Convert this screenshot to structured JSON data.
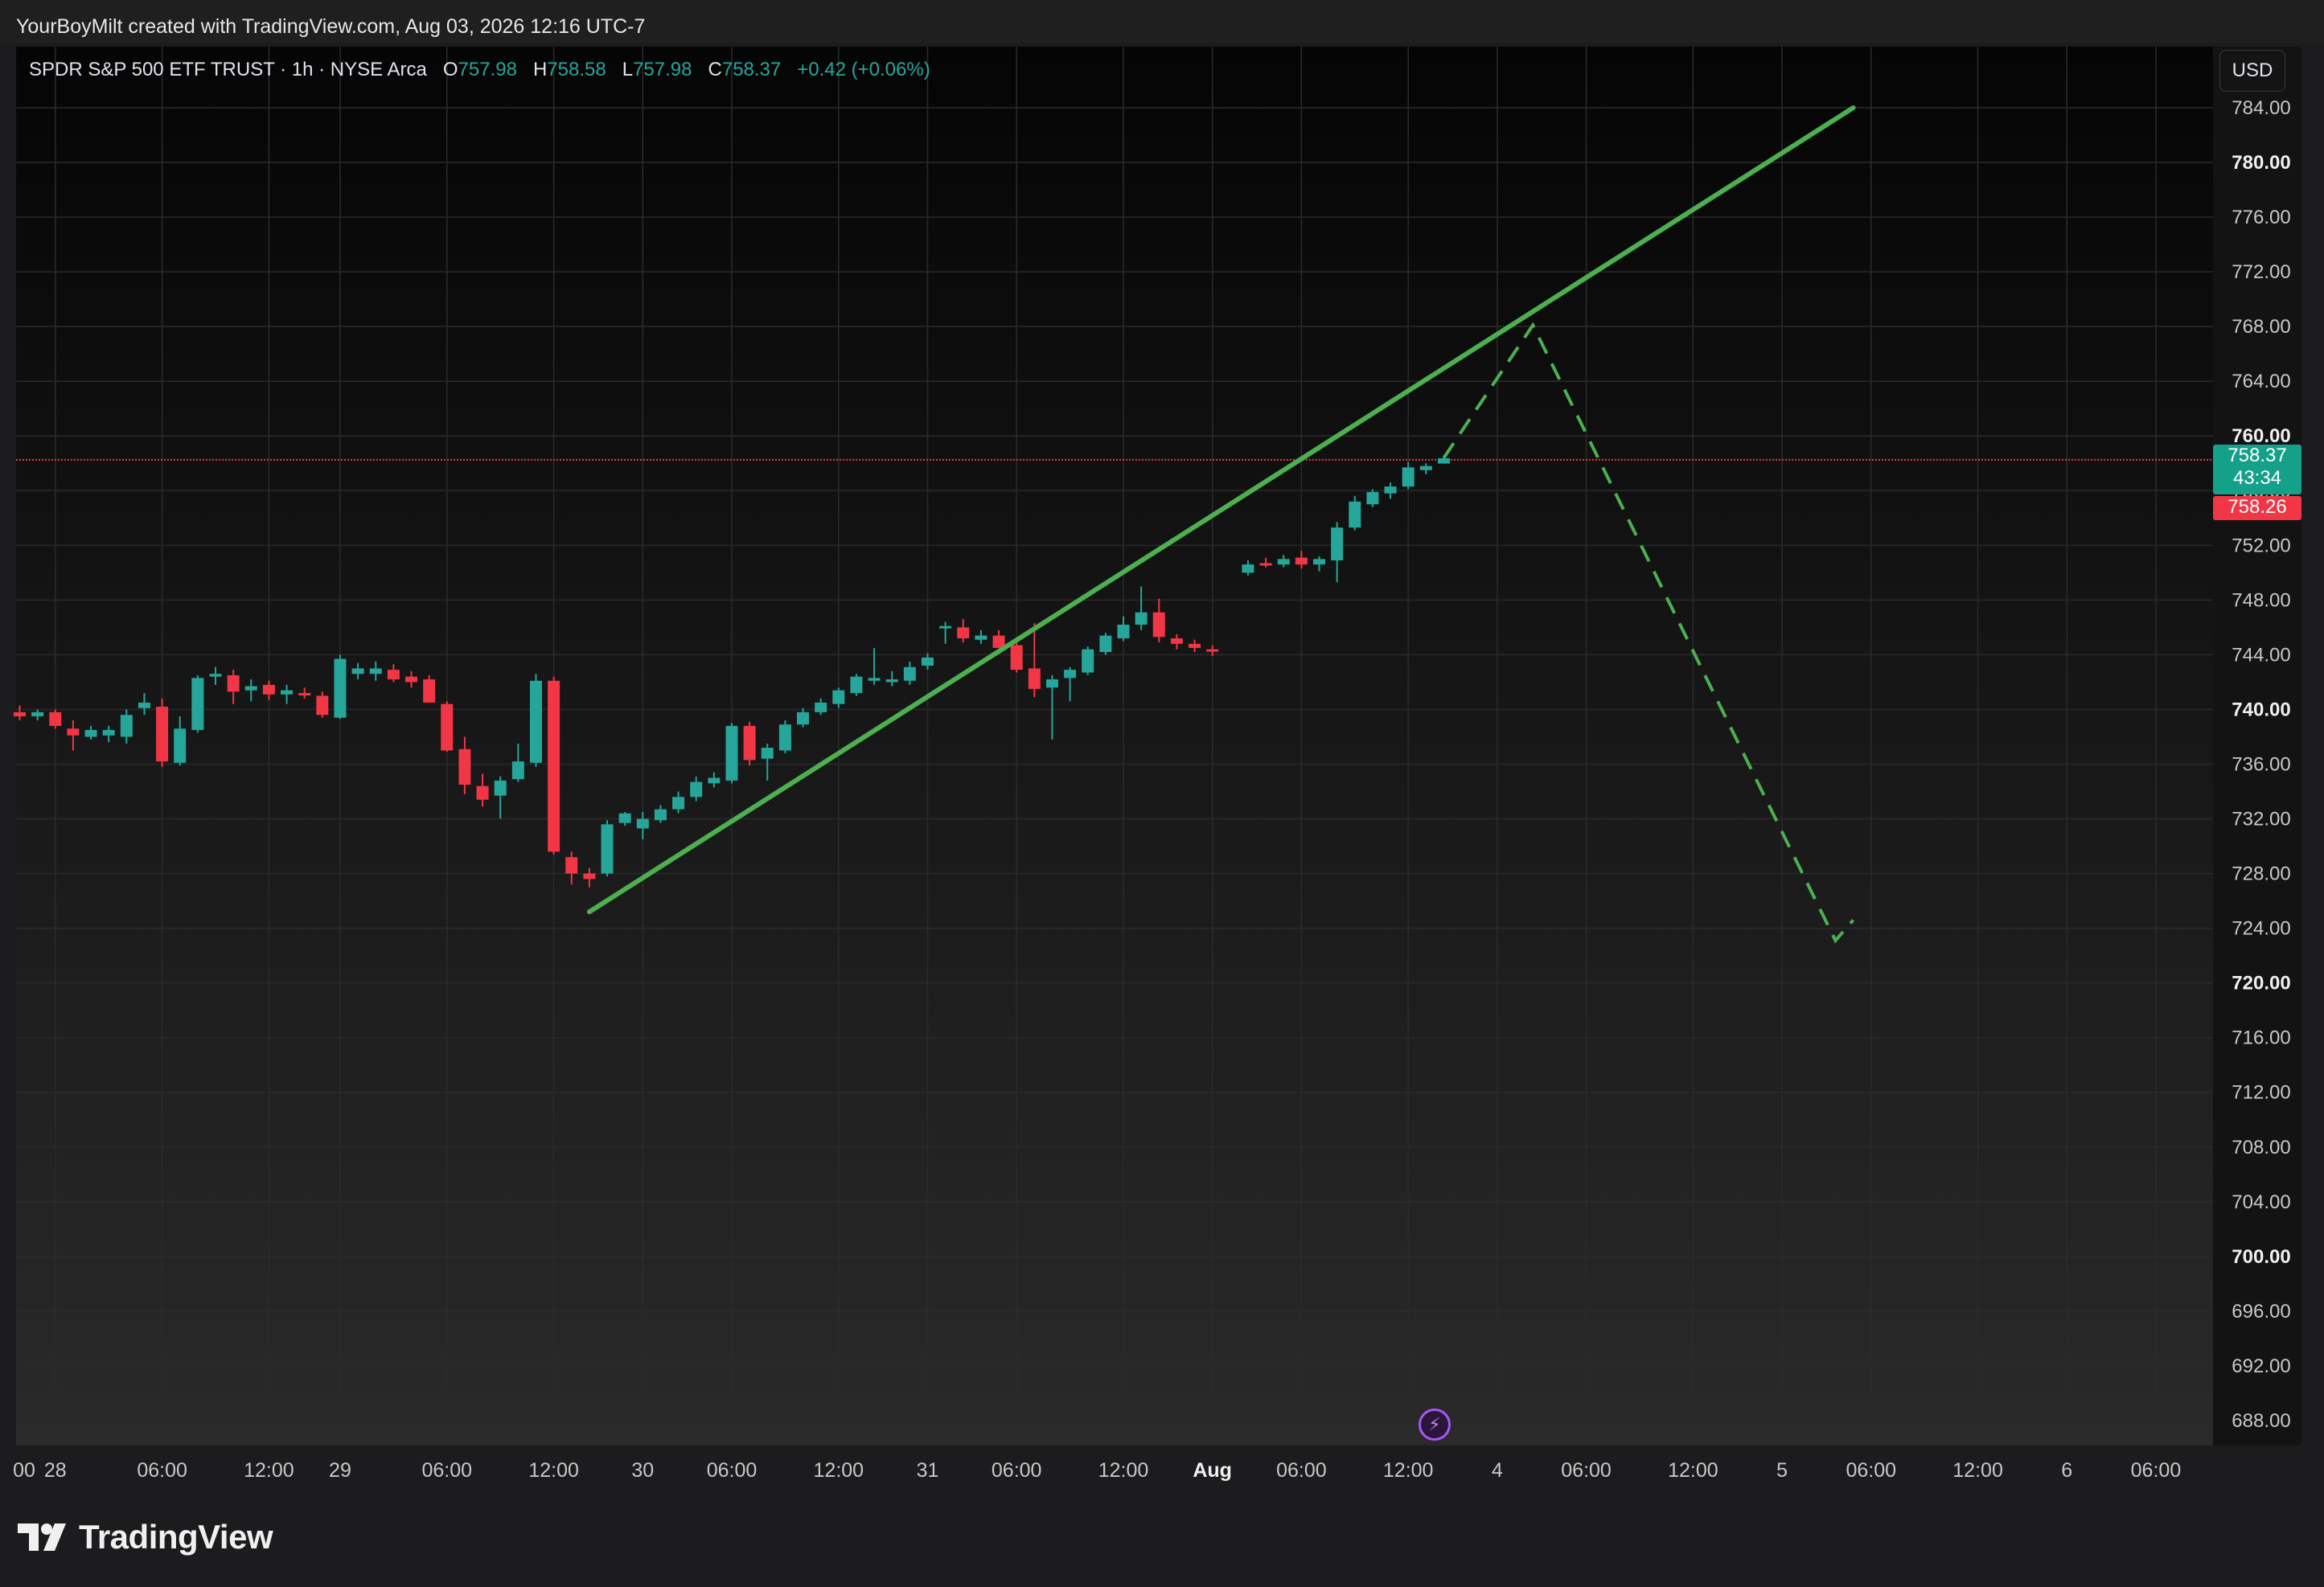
{
  "header": {
    "created_by": "YourBoyMilt created with TradingView.com, Aug 03, 2026 12:16 UTC-7"
  },
  "legend": {
    "symbol": "SPDR S&P 500 ETF TRUST · 1h · NYSE Arca",
    "open_label": "O",
    "open": "757.98",
    "high_label": "H",
    "high": "758.58",
    "low_label": "L",
    "low": "757.98",
    "close_label": "C",
    "close": "758.37",
    "change": "+0.42 (+0.06%)"
  },
  "currency": "USD",
  "price_tags": {
    "last_price": "758.37",
    "countdown": "43:34",
    "prev_close": "758.26"
  },
  "brand": {
    "name": "TradingView"
  },
  "colors": {
    "up": "#26a69a",
    "down": "#f23645",
    "trendline": "#4caf50",
    "projection": "#4caf50",
    "price_line": "#f23645"
  },
  "chart_data": {
    "type": "candlestick",
    "y_ticks": [
      "784.00",
      "780.00",
      "776.00",
      "772.00",
      "768.00",
      "764.00",
      "760.00",
      "756.00",
      "752.00",
      "748.00",
      "744.00",
      "740.00",
      "736.00",
      "732.00",
      "728.00",
      "724.00",
      "720.00",
      "716.00",
      "712.00",
      "708.00",
      "704.00",
      "700.00",
      "696.00",
      "692.00",
      "688.00"
    ],
    "ylim": [
      686,
      786
    ],
    "x_ticks": [
      {
        "label": "00",
        "i": -2,
        "bold": false
      },
      {
        "label": "28",
        "i": 2,
        "bold": false
      },
      {
        "label": "06:00",
        "i": 8,
        "bold": false
      },
      {
        "label": "12:00",
        "i": 14,
        "bold": false
      },
      {
        "label": "29",
        "i": 18,
        "bold": false
      },
      {
        "label": "06:00",
        "i": 24,
        "bold": false
      },
      {
        "label": "12:00",
        "i": 30,
        "bold": false
      },
      {
        "label": "30",
        "i": 35,
        "bold": false
      },
      {
        "label": "06:00",
        "i": 40,
        "bold": false
      },
      {
        "label": "12:00",
        "i": 46,
        "bold": false
      },
      {
        "label": "31",
        "i": 51,
        "bold": false
      },
      {
        "label": "06:00",
        "i": 56,
        "bold": false
      },
      {
        "label": "12:00",
        "i": 62,
        "bold": false
      },
      {
        "label": "Aug",
        "i": 67,
        "bold": true
      },
      {
        "label": "06:00",
        "i": 72,
        "bold": false
      },
      {
        "label": "12:00",
        "i": 78,
        "bold": false
      },
      {
        "label": "4",
        "i": 83,
        "bold": false
      },
      {
        "label": "06:00",
        "i": 88,
        "bold": false
      },
      {
        "label": "12:00",
        "i": 94,
        "bold": false
      },
      {
        "label": "5",
        "i": 99,
        "bold": false
      },
      {
        "label": "06:00",
        "i": 104,
        "bold": false
      },
      {
        "label": "12:00",
        "i": 110,
        "bold": false
      },
      {
        "label": "6",
        "i": 115,
        "bold": false
      },
      {
        "label": "06:00",
        "i": 120,
        "bold": false
      }
    ],
    "candles": [
      {
        "i": 0,
        "o": 739.8,
        "h": 740.3,
        "l": 739.2,
        "c": 739.5
      },
      {
        "i": 1,
        "o": 739.5,
        "h": 740.0,
        "l": 739.2,
        "c": 739.8
      },
      {
        "i": 2,
        "o": 739.8,
        "h": 740.0,
        "l": 738.6,
        "c": 738.8
      },
      {
        "i": 3,
        "o": 738.6,
        "h": 739.2,
        "l": 737.0,
        "c": 738.1
      },
      {
        "i": 4,
        "o": 738.0,
        "h": 738.8,
        "l": 737.8,
        "c": 738.5
      },
      {
        "i": 5,
        "o": 738.1,
        "h": 738.8,
        "l": 737.6,
        "c": 738.5
      },
      {
        "i": 6,
        "o": 738.0,
        "h": 740.0,
        "l": 737.5,
        "c": 739.6
      },
      {
        "i": 7,
        "o": 740.1,
        "h": 741.2,
        "l": 739.6,
        "c": 740.5
      },
      {
        "i": 8,
        "o": 740.2,
        "h": 740.8,
        "l": 735.8,
        "c": 736.2
      },
      {
        "i": 9,
        "o": 736.1,
        "h": 739.5,
        "l": 735.9,
        "c": 738.6
      },
      {
        "i": 10,
        "o": 738.5,
        "h": 742.5,
        "l": 738.3,
        "c": 742.3
      },
      {
        "i": 11,
        "o": 742.4,
        "h": 743.1,
        "l": 741.8,
        "c": 742.6
      },
      {
        "i": 12,
        "o": 742.5,
        "h": 742.9,
        "l": 740.4,
        "c": 741.3
      },
      {
        "i": 13,
        "o": 741.4,
        "h": 742.2,
        "l": 740.6,
        "c": 741.7
      },
      {
        "i": 14,
        "o": 741.8,
        "h": 742.1,
        "l": 740.7,
        "c": 741.1
      },
      {
        "i": 15,
        "o": 741.1,
        "h": 741.8,
        "l": 740.4,
        "c": 741.4
      },
      {
        "i": 16,
        "o": 741.2,
        "h": 741.6,
        "l": 740.8,
        "c": 741.1
      },
      {
        "i": 17,
        "o": 741.0,
        "h": 741.3,
        "l": 739.4,
        "c": 739.6
      },
      {
        "i": 18,
        "o": 739.4,
        "h": 744.0,
        "l": 739.3,
        "c": 743.7
      },
      {
        "i": 19,
        "o": 742.6,
        "h": 743.4,
        "l": 742.2,
        "c": 743.0
      },
      {
        "i": 20,
        "o": 742.6,
        "h": 743.5,
        "l": 742.1,
        "c": 743.0
      },
      {
        "i": 21,
        "o": 742.9,
        "h": 743.3,
        "l": 742.0,
        "c": 742.2
      },
      {
        "i": 22,
        "o": 742.4,
        "h": 742.8,
        "l": 741.6,
        "c": 742.0
      },
      {
        "i": 23,
        "o": 742.2,
        "h": 742.5,
        "l": 740.8,
        "c": 740.5
      },
      {
        "i": 24,
        "o": 740.4,
        "h": 740.6,
        "l": 736.9,
        "c": 737.0
      },
      {
        "i": 25,
        "o": 737.1,
        "h": 738.0,
        "l": 733.8,
        "c": 734.5
      },
      {
        "i": 26,
        "o": 734.4,
        "h": 735.3,
        "l": 732.9,
        "c": 733.4
      },
      {
        "i": 27,
        "o": 733.7,
        "h": 735.1,
        "l": 732.0,
        "c": 734.8
      },
      {
        "i": 28,
        "o": 734.9,
        "h": 737.5,
        "l": 734.7,
        "c": 736.2
      },
      {
        "i": 29,
        "o": 736.1,
        "h": 742.6,
        "l": 735.8,
        "c": 742.1
      },
      {
        "i": 30,
        "o": 742.1,
        "h": 742.4,
        "l": 729.4,
        "c": 729.6
      },
      {
        "i": 31,
        "o": 729.2,
        "h": 729.6,
        "l": 727.2,
        "c": 728.0
      },
      {
        "i": 32,
        "o": 728.0,
        "h": 728.4,
        "l": 727.0,
        "c": 727.6
      },
      {
        "i": 33,
        "o": 728.0,
        "h": 731.9,
        "l": 727.8,
        "c": 731.6
      },
      {
        "i": 34,
        "o": 731.7,
        "h": 732.5,
        "l": 731.5,
        "c": 732.4
      },
      {
        "i": 35,
        "o": 731.3,
        "h": 732.5,
        "l": 730.5,
        "c": 732.0
      },
      {
        "i": 36,
        "o": 731.9,
        "h": 733.0,
        "l": 731.7,
        "c": 732.7
      },
      {
        "i": 37,
        "o": 732.7,
        "h": 734.0,
        "l": 732.4,
        "c": 733.6
      },
      {
        "i": 38,
        "o": 733.6,
        "h": 735.1,
        "l": 733.3,
        "c": 734.7
      },
      {
        "i": 39,
        "o": 734.6,
        "h": 735.4,
        "l": 734.3,
        "c": 735.0
      },
      {
        "i": 40,
        "o": 734.8,
        "h": 739.0,
        "l": 734.6,
        "c": 738.8
      },
      {
        "i": 41,
        "o": 738.8,
        "h": 739.1,
        "l": 735.9,
        "c": 736.3
      },
      {
        "i": 42,
        "o": 736.4,
        "h": 737.5,
        "l": 734.8,
        "c": 737.2
      },
      {
        "i": 43,
        "o": 737.0,
        "h": 739.2,
        "l": 736.8,
        "c": 738.9
      },
      {
        "i": 44,
        "o": 738.9,
        "h": 740.1,
        "l": 738.7,
        "c": 739.8
      },
      {
        "i": 45,
        "o": 739.8,
        "h": 740.8,
        "l": 739.6,
        "c": 740.5
      },
      {
        "i": 46,
        "o": 740.4,
        "h": 741.6,
        "l": 740.1,
        "c": 741.4
      },
      {
        "i": 47,
        "o": 741.2,
        "h": 742.6,
        "l": 741.0,
        "c": 742.4
      },
      {
        "i": 48,
        "o": 742.1,
        "h": 744.5,
        "l": 741.8,
        "c": 742.3
      },
      {
        "i": 49,
        "o": 742.0,
        "h": 742.8,
        "l": 741.7,
        "c": 742.2
      },
      {
        "i": 50,
        "o": 742.1,
        "h": 743.5,
        "l": 741.8,
        "c": 743.1
      },
      {
        "i": 51,
        "o": 743.2,
        "h": 744.1,
        "l": 742.9,
        "c": 743.8
      },
      {
        "i": 52,
        "o": 746.0,
        "h": 746.4,
        "l": 744.8,
        "c": 746.1
      },
      {
        "i": 53,
        "o": 746.0,
        "h": 746.6,
        "l": 744.9,
        "c": 745.2
      },
      {
        "i": 54,
        "o": 745.1,
        "h": 745.8,
        "l": 744.8,
        "c": 745.4
      },
      {
        "i": 55,
        "o": 745.4,
        "h": 745.8,
        "l": 744.5,
        "c": 744.5
      },
      {
        "i": 56,
        "o": 744.7,
        "h": 744.9,
        "l": 742.7,
        "c": 742.9
      },
      {
        "i": 57,
        "o": 743.0,
        "h": 746.3,
        "l": 740.9,
        "c": 741.5
      },
      {
        "i": 58,
        "o": 741.6,
        "h": 742.5,
        "l": 737.8,
        "c": 742.2
      },
      {
        "i": 59,
        "o": 742.3,
        "h": 743.1,
        "l": 740.6,
        "c": 742.9
      },
      {
        "i": 60,
        "o": 742.7,
        "h": 744.6,
        "l": 742.5,
        "c": 744.4
      },
      {
        "i": 61,
        "o": 744.2,
        "h": 745.6,
        "l": 744.0,
        "c": 745.4
      },
      {
        "i": 62,
        "o": 745.2,
        "h": 746.8,
        "l": 745.0,
        "c": 746.2
      },
      {
        "i": 63,
        "o": 746.2,
        "h": 749.0,
        "l": 745.8,
        "c": 747.1
      },
      {
        "i": 64,
        "o": 747.1,
        "h": 748.1,
        "l": 744.9,
        "c": 745.3
      },
      {
        "i": 65,
        "o": 745.2,
        "h": 745.5,
        "l": 744.4,
        "c": 744.8
      },
      {
        "i": 66,
        "o": 744.8,
        "h": 745.1,
        "l": 744.2,
        "c": 744.5
      },
      {
        "i": 67,
        "o": 744.4,
        "h": 744.7,
        "l": 743.9,
        "c": 744.3
      },
      {
        "i": 69,
        "o": 750.0,
        "h": 750.9,
        "l": 749.8,
        "c": 750.6
      },
      {
        "i": 70,
        "o": 750.7,
        "h": 751.1,
        "l": 750.4,
        "c": 750.6
      },
      {
        "i": 71,
        "o": 750.6,
        "h": 751.3,
        "l": 750.4,
        "c": 751.0
      },
      {
        "i": 72,
        "o": 751.1,
        "h": 751.6,
        "l": 750.3,
        "c": 750.6
      },
      {
        "i": 73,
        "o": 750.6,
        "h": 751.2,
        "l": 750.1,
        "c": 751.0
      },
      {
        "i": 74,
        "o": 750.9,
        "h": 753.7,
        "l": 749.3,
        "c": 753.3
      },
      {
        "i": 75,
        "o": 753.3,
        "h": 755.6,
        "l": 753.1,
        "c": 755.2
      },
      {
        "i": 76,
        "o": 755.0,
        "h": 756.1,
        "l": 754.8,
        "c": 755.9
      },
      {
        "i": 77,
        "o": 755.8,
        "h": 756.6,
        "l": 755.4,
        "c": 756.3
      },
      {
        "i": 78,
        "o": 756.3,
        "h": 758.1,
        "l": 756.1,
        "c": 757.7
      },
      {
        "i": 79,
        "o": 757.5,
        "h": 758.0,
        "l": 757.2,
        "c": 757.8
      },
      {
        "i": 80,
        "o": 757.98,
        "h": 758.58,
        "l": 757.98,
        "c": 758.37
      }
    ],
    "trendline": [
      {
        "i": 32,
        "y": 725.2
      },
      {
        "i": 103,
        "y": 784.0
      }
    ],
    "projection": [
      {
        "i": 80,
        "y": 758.4
      },
      {
        "i": 85,
        "y": 768.1
      },
      {
        "i": 102,
        "y": 723.1
      },
      {
        "i": 103,
        "y": 724.6
      }
    ],
    "price_line": 758.26
  }
}
